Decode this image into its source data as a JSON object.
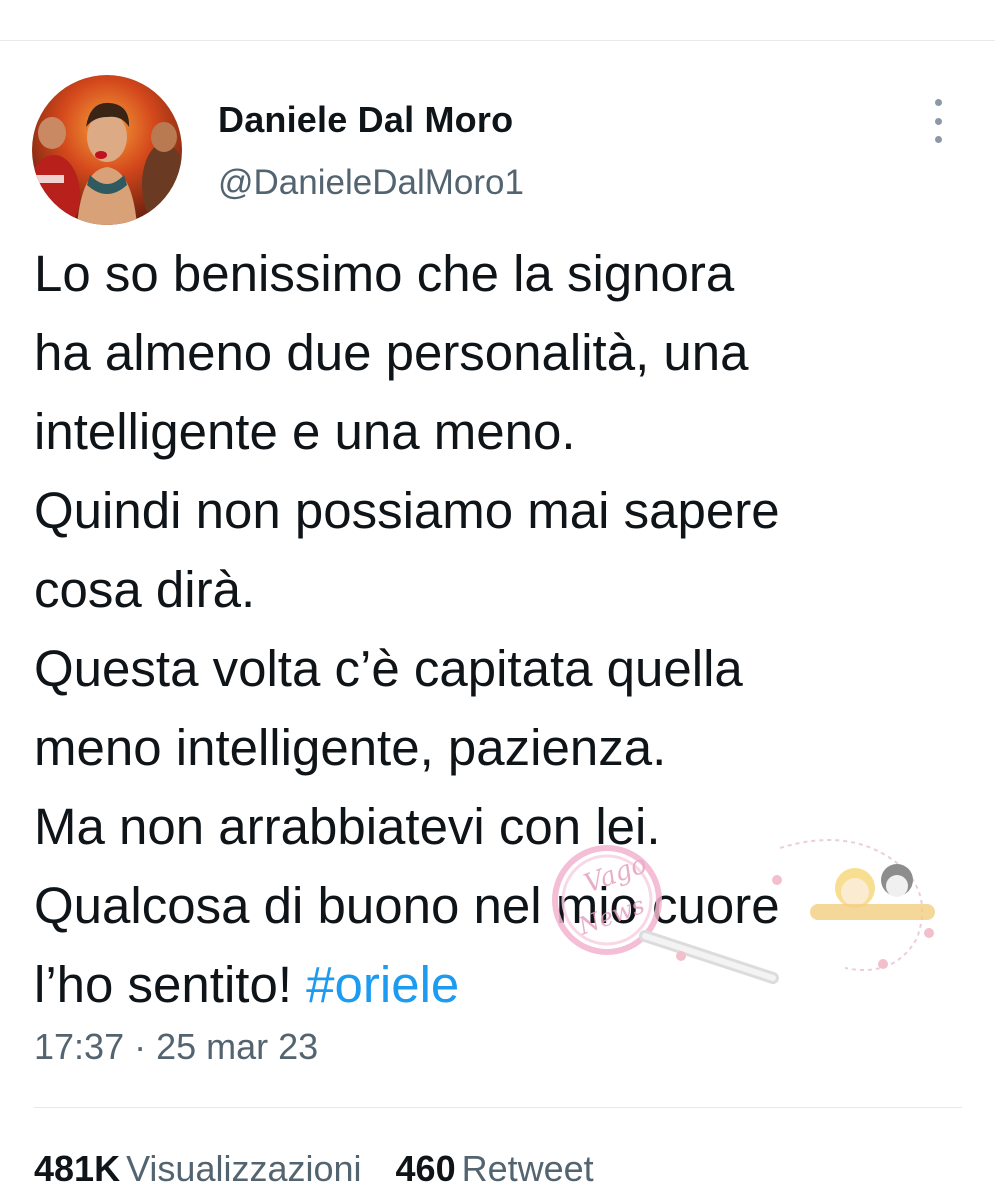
{
  "author": {
    "name": "Daniele Dal Moro",
    "handle": "@DanieleDalMoro1",
    "avatar_icon": "profile-photo"
  },
  "more_icon": "more-vertical-icon",
  "tweet": {
    "lines": [
      "Lo so benissimo che la signora",
      "ha almeno due personalità, una",
      "intelligente e una meno.",
      "Quindi non possiamo mai sapere",
      "cosa dirà.",
      "Questa volta c’è capitata quella",
      "meno intelligente, pazienza.",
      "Ma non arrabbiatevi con lei.",
      "Qualcosa di buono nel mio cuore"
    ],
    "last_line_text": "l’ho sentito! ",
    "hashtag": "#oriele",
    "timestamp": "17:37 · 25 mar 23"
  },
  "watermark": {
    "text_main": "Vago",
    "text_sub": "News"
  },
  "stats": {
    "views_count": "481K",
    "views_label": "Visualizzazioni",
    "retweets_count": "460",
    "retweets_label": "Retweet"
  },
  "colors": {
    "text": "#0f1419",
    "secondary": "#536471",
    "link": "#1d9bf0",
    "divider": "#e6e9ea"
  }
}
